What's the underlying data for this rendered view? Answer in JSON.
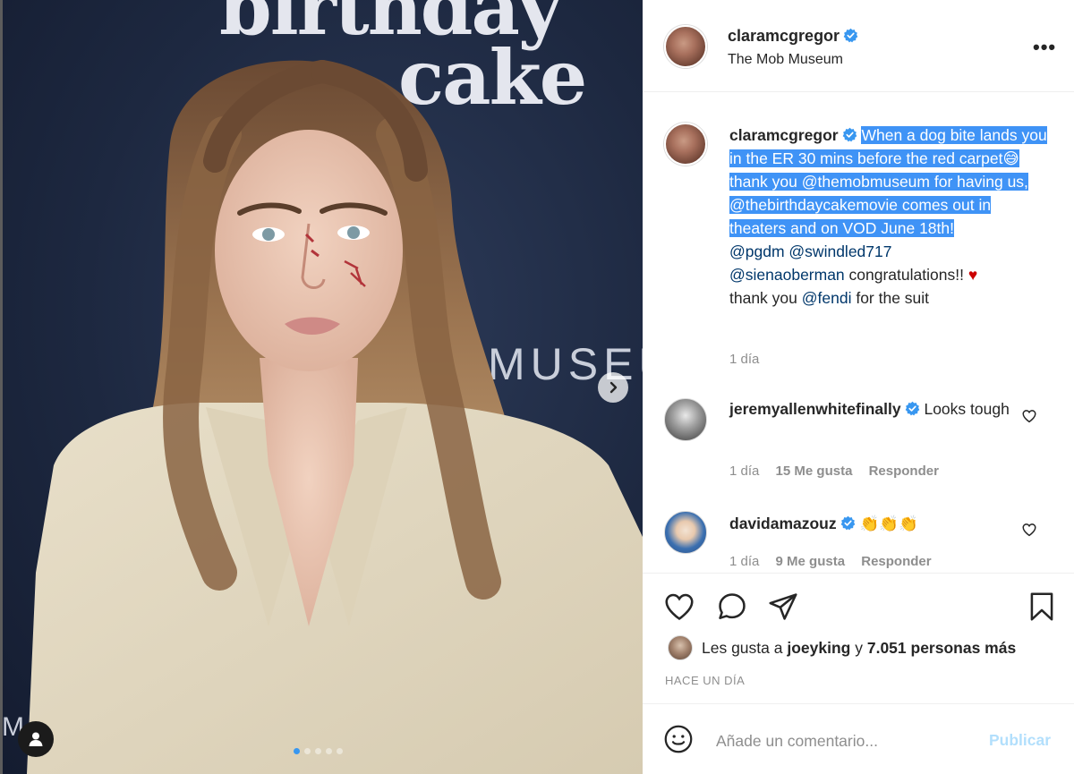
{
  "post": {
    "backdrop": {
      "line1": "birthday",
      "line2": "cake",
      "museum": "MUSEU",
      "corner": "M"
    },
    "carousel": {
      "count": 5,
      "active": 0
    }
  },
  "header": {
    "username": "claramcgregor",
    "location": "The Mob Museum",
    "more": "•••"
  },
  "caption": {
    "username": "claramcgregor",
    "highlighted_text": "When a dog bite lands you in the ER 30 mins before the red carpet😅 thank you @themobmuseum for having us, @thebirthdaycakemovie comes out in theaters and on VOD June 18th!",
    "mention_1": "@pgdm",
    "mention_2": "@swindled717",
    "mention_3": "@sienaoberman",
    "text_congrats": " congratulations!! ",
    "heart": "♥",
    "text_thanks": "thank you ",
    "mention_4": "@fendi",
    "text_suit": " for the suit",
    "time": "1 día"
  },
  "comments": [
    {
      "username": "jeremyallenwhitefinally",
      "text": " Looks tough",
      "time": "1 día",
      "likes": "15 Me gusta",
      "reply": "Responder"
    },
    {
      "username": "davidamazouz",
      "text": " 👏👏👏",
      "time": "1 día",
      "likes": "9 Me gusta",
      "reply": "Responder"
    }
  ],
  "likes": {
    "prefix": "Les gusta a ",
    "user": "joeyking",
    "middle": " y ",
    "count": "7.051 personas más"
  },
  "timestamp": "HACE UN DÍA",
  "add_comment": {
    "placeholder": "Añade un comentario...",
    "publish": "Publicar"
  }
}
